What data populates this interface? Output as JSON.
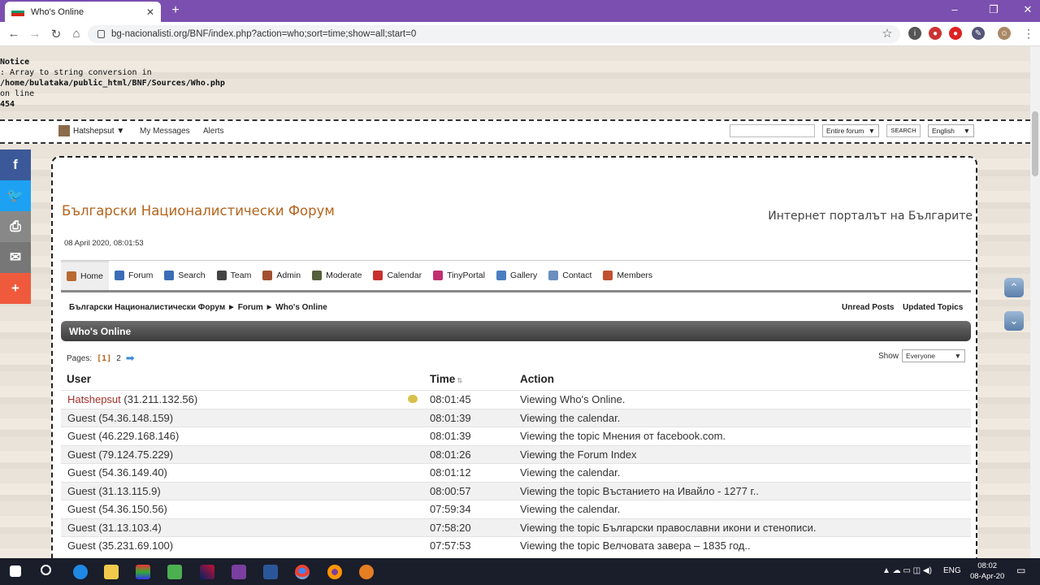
{
  "browser": {
    "tab_title": "Who's Online",
    "url": "bg-nacionalisti.org/BNF/index.php?action=who;sort=time;show=all;start=0"
  },
  "notice": {
    "title": "Notice",
    "line1": ": Array to string conversion in",
    "path": "/home/bulataka/public_html/BNF/Sources/Who.php",
    "line3": "on line",
    "line_no": "454"
  },
  "topbar": {
    "username": "Hatshepsut ▼",
    "messages": "My Messages",
    "alerts": "Alerts",
    "scope_select": "Entire forum",
    "search_button": "SEARCH",
    "language": "English"
  },
  "site": {
    "title": "Български Националистически Форум",
    "tagline": "Интернет порталът на Българите",
    "date": "08 April 2020, 08:01:53"
  },
  "menu": [
    {
      "label": "Home",
      "icon": "home-icon",
      "color": "#b86a32"
    },
    {
      "label": "Forum",
      "icon": "forum-icon",
      "color": "#3b6db5"
    },
    {
      "label": "Search",
      "icon": "search-icon",
      "color": "#3b6db5"
    },
    {
      "label": "Team",
      "icon": "team-icon",
      "color": "#444444"
    },
    {
      "label": "Admin",
      "icon": "admin-icon",
      "color": "#a05030"
    },
    {
      "label": "Moderate",
      "icon": "moderate-icon",
      "color": "#55603a"
    },
    {
      "label": "Calendar",
      "icon": "calendar-icon",
      "color": "#c83030"
    },
    {
      "label": "TinyPortal",
      "icon": "tinyportal-icon",
      "color": "#c03070"
    },
    {
      "label": "Gallery",
      "icon": "gallery-icon",
      "color": "#4a7fbf"
    },
    {
      "label": "Contact",
      "icon": "contact-icon",
      "color": "#6a8fbf"
    },
    {
      "label": "Members",
      "icon": "members-icon",
      "color": "#c05030"
    }
  ],
  "breadcrumb": {
    "root": "Български Националистически Форум",
    "sep": "►",
    "forum": "Forum",
    "current": "Who's Online",
    "unread": "Unread Posts",
    "updated": "Updated Topics"
  },
  "section_title": "Who's Online",
  "pagination": {
    "label": "Pages:",
    "current": "[1]",
    "next": "2"
  },
  "show": {
    "label": "Show",
    "value": "Everyone"
  },
  "columns": {
    "user": "User",
    "time": "Time",
    "action": "Action"
  },
  "rows": [
    {
      "user": "Hatshepsut",
      "ip": "(31.211.132.56)",
      "time": "08:01:45",
      "action": "Viewing Who's Online."
    },
    {
      "user": "Guest",
      "ip": "(54.36.148.159)",
      "time": "08:01:39",
      "action": "Viewing the calendar."
    },
    {
      "user": "Guest",
      "ip": "(46.229.168.146)",
      "time": "08:01:39",
      "action": "Viewing the topic Мнения от facebook.com."
    },
    {
      "user": "Guest",
      "ip": "(79.124.75.229)",
      "time": "08:01:26",
      "action": "Viewing the Forum Index"
    },
    {
      "user": "Guest",
      "ip": "(54.36.149.40)",
      "time": "08:01:12",
      "action": "Viewing the calendar."
    },
    {
      "user": "Guest",
      "ip": "(31.13.115.9)",
      "time": "08:00:57",
      "action": "Viewing the topic Въстанието на Ивайло - 1277 г.."
    },
    {
      "user": "Guest",
      "ip": "(54.36.150.56)",
      "time": "07:59:34",
      "action": "Viewing the calendar."
    },
    {
      "user": "Guest",
      "ip": "(31.13.103.4)",
      "time": "07:58:20",
      "action": "Viewing the topic Български православни икони и стенописи."
    },
    {
      "user": "Guest",
      "ip": "(35.231.69.100)",
      "time": "07:57:53",
      "action": "Viewing the topic Велчовата завера – 1835 год.."
    }
  ],
  "taskbar": {
    "lang": "ENG",
    "time": "08:02",
    "date": "08-Apr-20"
  }
}
